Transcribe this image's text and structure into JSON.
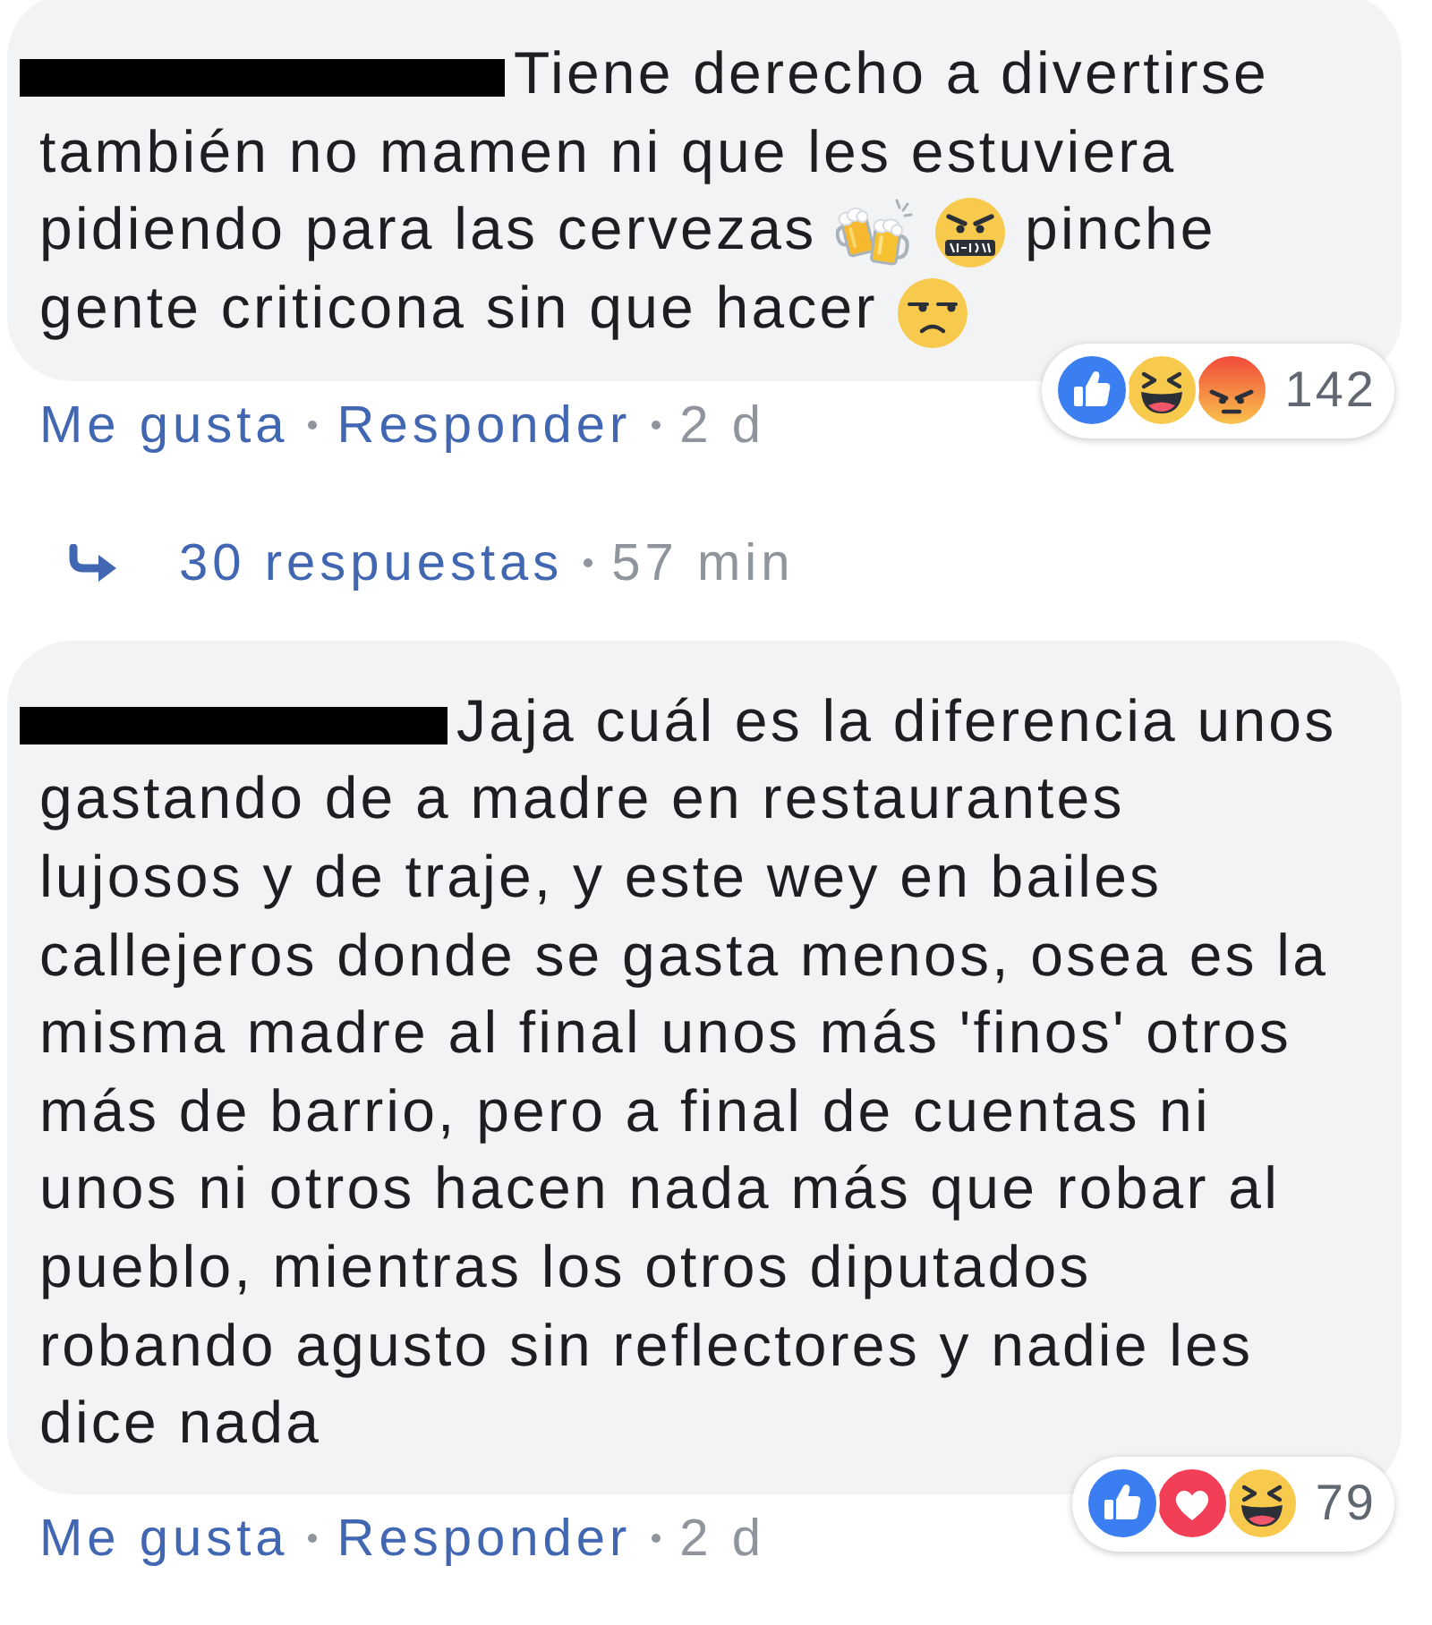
{
  "comments": [
    {
      "author_redacted": true,
      "body": [
        {
          "kind": "text",
          "text": "Tiene derecho a divertirse también no mamen ni que les estuviera pidiendo para las cervezas"
        },
        {
          "kind": "beers"
        },
        {
          "kind": "cursing"
        },
        {
          "kind": "text",
          "text": "pinche gente criticona sin que hacer"
        },
        {
          "kind": "unamused"
        }
      ],
      "reactions": [
        {
          "kind": "like"
        },
        {
          "kind": "haha"
        },
        {
          "kind": "angry"
        }
      ],
      "reaction_count": "142",
      "actions": [
        "Me gusta",
        "Responder"
      ],
      "time": "2 d",
      "replies": {
        "label": "30 respuestas",
        "time": "57 min"
      }
    },
    {
      "author_redacted": true,
      "body": [
        {
          "kind": "text",
          "text": "Jaja cuál es la diferencia unos gastando de a madre en restaurantes lujosos y de traje, y este wey en bailes callejeros donde se gasta menos, osea es la misma madre al final unos más 'finos' otros más de barrio, pero a final de cuentas ni unos ni otros hacen nada más que robar al pueblo, mientras los otros diputados robando agusto sin reflectores y nadie les dice nada"
        }
      ],
      "reactions": [
        {
          "kind": "like"
        },
        {
          "kind": "love"
        },
        {
          "kind": "haha"
        }
      ],
      "reaction_count": "79",
      "actions": [
        "Me gusta",
        "Responder"
      ],
      "time": "2 d"
    }
  ]
}
